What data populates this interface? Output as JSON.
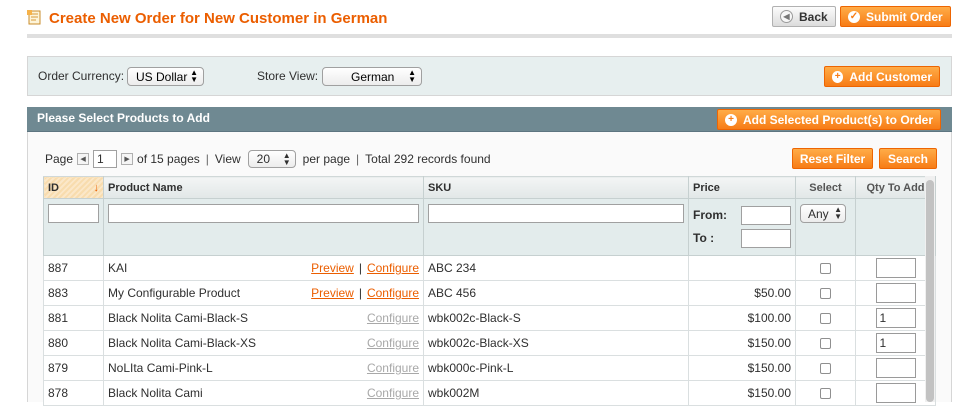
{
  "header": {
    "title": "Create New Order for New Customer in German",
    "back_label": "Back",
    "submit_label": "Submit Order"
  },
  "currency_bar": {
    "currency_label": "Order Currency:",
    "currency_value": "US Dollar",
    "store_view_label": "Store View:",
    "store_view_value": "German",
    "add_customer_label": "Add Customer"
  },
  "grid": {
    "title": "Please Select Products to Add",
    "add_selected_label": "Add Selected Product(s) to Order",
    "pager": {
      "page_label": "Page",
      "page_value": "1",
      "of_pages": "of 15 pages",
      "view_label": "View",
      "per_page_value": "20",
      "per_page_label": "per page",
      "total": "Total 292 records found"
    },
    "reset_filter_label": "Reset Filter",
    "search_label": "Search",
    "columns": {
      "id": "ID",
      "name": "Product Name",
      "sku": "SKU",
      "price": "Price",
      "select": "Select",
      "qty": "Qty To Add"
    },
    "filter": {
      "from_label": "From:",
      "to_label": "To :",
      "select_any": "Any"
    },
    "action_preview": "Preview",
    "action_configure": "Configure",
    "rows": [
      {
        "id": "887",
        "name": "KAI",
        "sku": "ABC 234",
        "price": "",
        "qty": ""
      },
      {
        "id": "883",
        "name": "My Configurable Product",
        "sku": "ABC 456",
        "price": "$50.00",
        "qty": ""
      },
      {
        "id": "881",
        "name": "Black Nolita Cami-Black-S",
        "sku": "wbk002c-Black-S",
        "price": "$100.00",
        "qty": "1"
      },
      {
        "id": "880",
        "name": "Black Nolita Cami-Black-XS",
        "sku": "wbk002c-Black-XS",
        "price": "$150.00",
        "qty": "1"
      },
      {
        "id": "879",
        "name": "NoLIta Cami-Pink-L",
        "sku": "wbk000c-Pink-L",
        "price": "$150.00",
        "qty": ""
      },
      {
        "id": "878",
        "name": "Black Nolita Cami",
        "sku": "wbk002M",
        "price": "$150.00",
        "qty": ""
      }
    ]
  },
  "colors": {
    "accent": "#eb5e00",
    "button_orange": "#f77c16",
    "grid_header": "#6f8992",
    "filter_bg": "#e3ecec"
  }
}
